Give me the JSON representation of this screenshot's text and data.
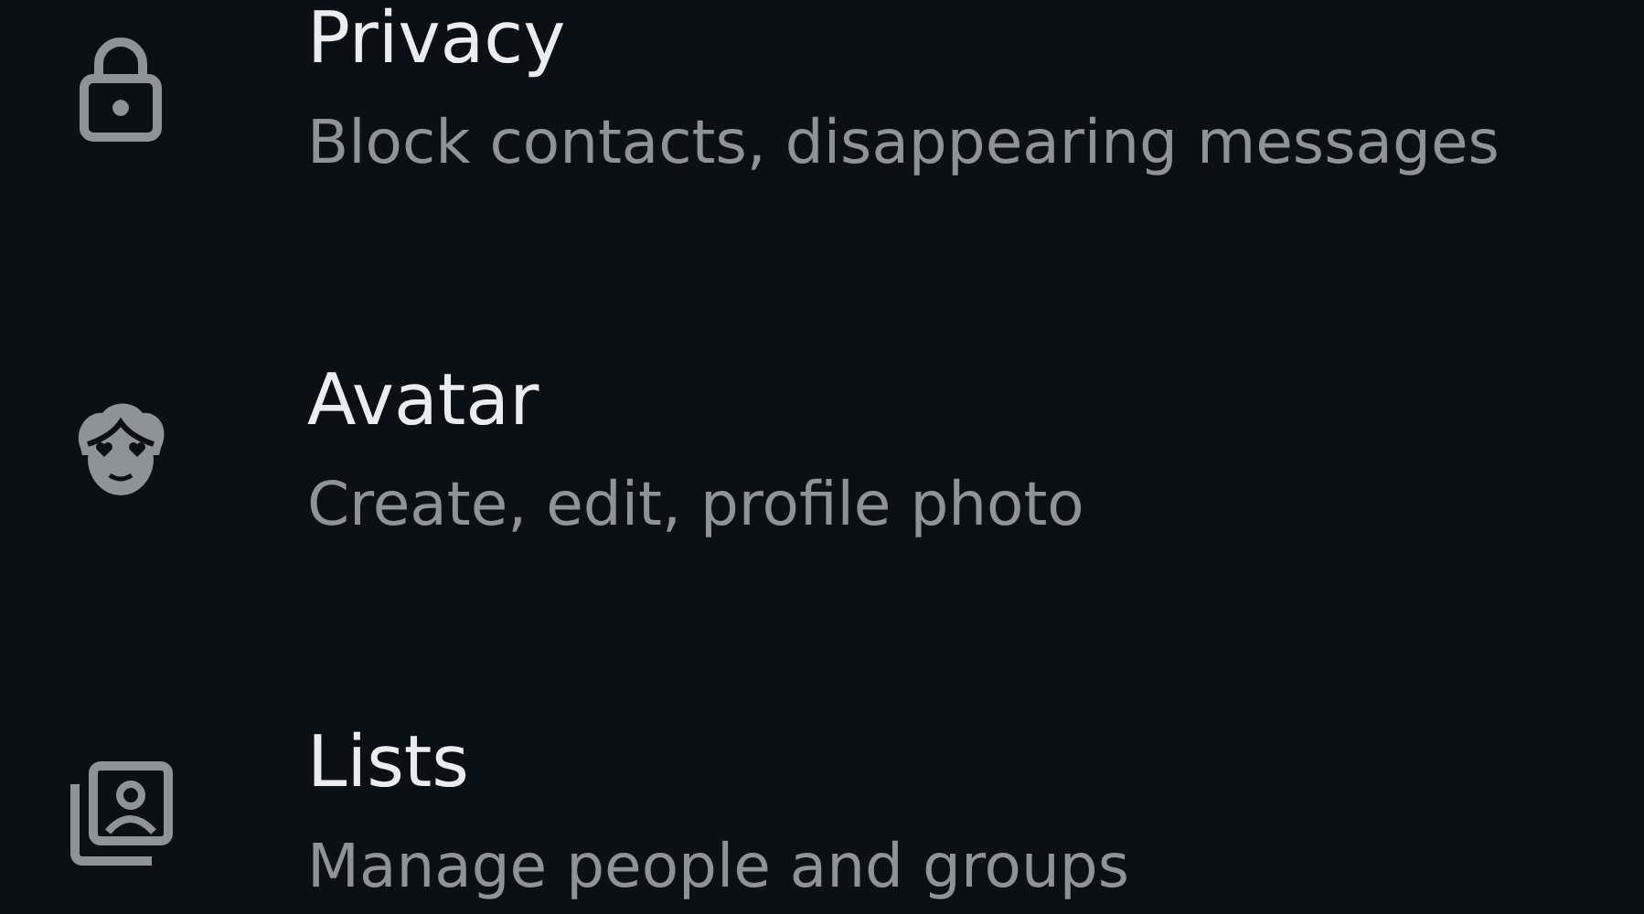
{
  "settings_items": [
    {
      "kind": "lock",
      "title": "Privacy",
      "subtitle": "Block contacts, disappearing messages"
    },
    {
      "kind": "avatar",
      "title": "Avatar",
      "subtitle": "Create, edit, profile photo"
    },
    {
      "kind": "lists",
      "title": "Lists",
      "subtitle": "Manage people and groups"
    }
  ]
}
